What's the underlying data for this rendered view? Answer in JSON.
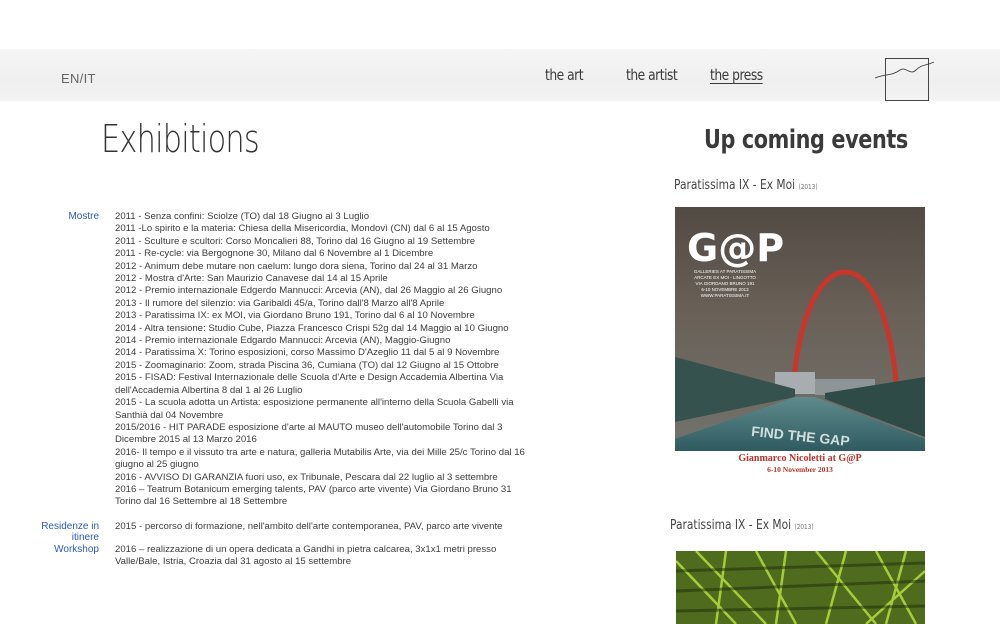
{
  "header": {
    "lang_toggle": "EN/IT",
    "nav": [
      {
        "label": "the art",
        "active": false
      },
      {
        "label": "the artist",
        "active": false
      },
      {
        "label": "the press",
        "active": true
      }
    ],
    "logo_icon": "signature-logo-icon"
  },
  "main": {
    "title": "Exhibitions",
    "sections": [
      {
        "label": "Mostre",
        "entries": [
          "2011 - Senza confini: Sciolze (TO) dal 18 Giugno al 3 Luglio",
          "2011 -Lo spirito e la materia: Chiesa della Misericordia, Mondovì (CN) dal 6 al 15 Agosto",
          "2011 - Sculture e scultori: Corso Moncalieri 88, Torino dal 16 Giugno al 19 Settembre",
          "2011 - Re-cycle: via Bergognone 30, Milano dal 6 Novembre al 1 Dicembre",
          "2012 - Animum debe mutare non caelum: lungo dora siena, Torino dal 24 al 31 Marzo",
          "2012 - Mostra d'Arte: San Maurizio Canavese dal 14 al 15 Aprile",
          "2012 - Premio internazionale Edgerdo Mannucci: Arcevia (AN), dal 26 Maggio al 26 Giugno",
          "2013 - Il rumore del silenzio: via Garibaldi 45/a, Torino dall'8 Marzo all'8 Aprile",
          "2013 - Paratissima IX: ex MOI, via Giordano Bruno 191, Torino dal 6 al 10 Novembre",
          "2014 - Altra tensione: Studio Cube, Piazza Francesco Crispi 52g dal 14 Maggio al 10 Giugno",
          "2014 - Premio internazionale Edgardo Mannucci: Arcevia (AN), Maggio-Giugno",
          "2014 - Paratissima X: Torino esposizioni, corso Massimo D'Azeglio 11 dal 5 al 9 Novembre",
          "2015 - Zoomaginario: Zoom, strada Piscina 36, Cumiana (TO) dal 12 Giugno al 15 Ottobre",
          "2015 - FISAD: Festival Internazionale delle Scuola d'Arte e Design Accademia Albertina Via dell'Accademia Albertina 8 dal 1 al 26 Luglio",
          "2015 - La scuola adotta un Artista: esposizione permanente all'interno della Scuola Gabelli via Santhià dal 04 Novembre",
          "2015/2016 - HIT PARADE esposizione d'arte al MAUTO museo dell'automobile Torino dal 3 Dicembre 2015 al 13 Marzo 2016",
          "2016- Il tempo e il vissuto tra arte e natura, galleria Mutabilis Arte, via dei Mille 25/c Torino dal 16 giugno al 25 giugno",
          "2016 - AVVISO DI GARANZIA fuori uso, ex Tribunale, Pescara dal 22 luglio al 3 settembre",
          "2016 – Teatrum Botanicum emerging talents, PAV (parco arte vivente) Via Giordano Bruno 31 Torino dal 16 Settembre al 18 Settembre"
        ]
      },
      {
        "label": "Residenze in itinere",
        "entries": [
          "2015 - percorso di formazione, nell'ambito dell'arte contemporanea, PAV, parco arte vivente"
        ]
      },
      {
        "label": "Workshop",
        "entries": [
          "2016 – realizzazione di un opera dedicata a Gandhi in pietra calcarea, 3x1x1 metri presso Valle/Bale, Istria, Croazia dal 31 agosto al 15 settembre"
        ]
      }
    ]
  },
  "sidebar": {
    "title": "Up coming events",
    "events": [
      {
        "name": "Paratissima IX -  Ex Moi",
        "year": "(2013)",
        "poster": {
          "logo": "G@P",
          "lines": [
            "GALLERIES AT PARATISSIMA",
            "ARCATE EX MOI - LINGOTTO",
            "VIA GIORDANO BRUNO 191",
            "6-10 NOVEMBRE 2013",
            "WWW.PARATISSIMA.IT"
          ],
          "road_text": "FIND THE GAP",
          "caption_artist": "Gianmarco Nicoletti at G@P",
          "caption_dates": "6-10 November 2013"
        }
      },
      {
        "name": "Paratissima IX -  Ex Moi",
        "year": "(2013)"
      }
    ]
  }
}
